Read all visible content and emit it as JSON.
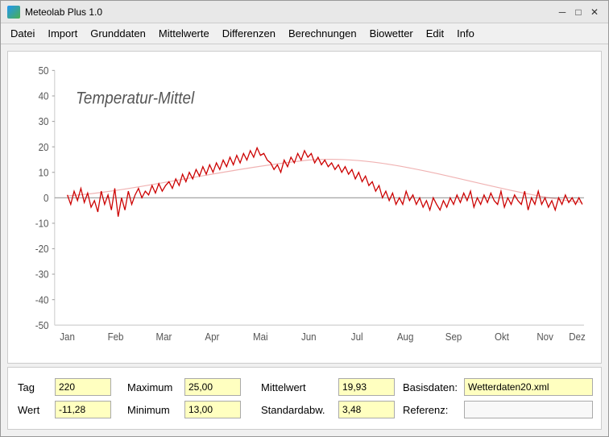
{
  "window": {
    "title": "Meteolab Plus 1.0",
    "icon": "app-icon"
  },
  "titlebar": {
    "minimize_label": "─",
    "maximize_label": "□",
    "close_label": "✕"
  },
  "menu": {
    "items": [
      {
        "label": "Datei"
      },
      {
        "label": "Import"
      },
      {
        "label": "Grunddaten"
      },
      {
        "label": "Mittelwerte"
      },
      {
        "label": "Differenzen"
      },
      {
        "label": "Berechnungen"
      },
      {
        "label": "Biowetter"
      },
      {
        "label": "Edit"
      },
      {
        "label": "Info"
      }
    ]
  },
  "chart": {
    "title": "Temperatur-Mittel",
    "y_axis": {
      "max": 50,
      "ticks": [
        50,
        40,
        30,
        20,
        10,
        0,
        -10,
        -20,
        -30,
        -40,
        -50
      ]
    },
    "x_axis": {
      "labels": [
        "Jan",
        "Feb",
        "Mar",
        "Apr",
        "Mai",
        "Jun",
        "Jul",
        "Aug",
        "Sep",
        "Okt",
        "Nov",
        "Dez"
      ]
    }
  },
  "bottom_fields": {
    "tag_label": "Tag",
    "tag_value": "220",
    "wert_label": "Wert",
    "wert_value": "-11,28",
    "maximum_label": "Maximum",
    "maximum_value": "25,00",
    "minimum_label": "Minimum",
    "minimum_value": "13,00",
    "mittelwert_label": "Mittelwert",
    "mittelwert_value": "19,93",
    "standardabw_label": "Standardabw.",
    "standardabw_value": "3,48",
    "basisdaten_label": "Basisdaten:",
    "basisdaten_value": "Wetterdaten20.xml",
    "referenz_label": "Referenz:",
    "referenz_value": ""
  }
}
